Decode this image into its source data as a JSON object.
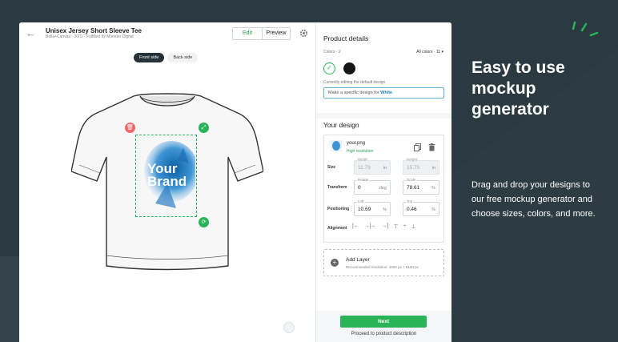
{
  "product": {
    "title": "Unisex Jersey Short Sleeve Tee",
    "subtitle": "Bella+Canvas · 3001 · Fulfilled by Monster Digital"
  },
  "header": {
    "edit_label": "Edit",
    "preview_label": "Preview"
  },
  "sides": {
    "front": "Front side",
    "back": "Back side"
  },
  "design_art_text": "Your Brand",
  "details": {
    "title": "Product details",
    "colors_label": "Colors · 2",
    "all_colors": "All colors · 11",
    "editing_note": "Currently editing the default design",
    "specific_prefix": "Make a specific design for ",
    "specific_color": "White",
    "swatches": [
      "#ffffff",
      "#151515"
    ]
  },
  "design": {
    "title": "Your design",
    "file_name": "your.png",
    "file_res": "High resolution",
    "size_label": "Size",
    "width_label": "Width",
    "width_value": "11.79",
    "width_unit": "in",
    "height_label": "Height",
    "height_value": "15.75",
    "height_unit": "in",
    "transform_label": "Transform",
    "rotate_label": "Rotate",
    "rotate_value": "0",
    "rotate_unit": "deg",
    "scale_label": "Scale",
    "scale_value": "78.61",
    "scale_unit": "%",
    "positioning_label": "Positioning",
    "left_label": "Left",
    "left_value": "10.69",
    "left_unit": "%",
    "top_label": "Top",
    "top_value": "0.46",
    "top_unit": "%",
    "alignment_label": "Alignment",
    "add_layer": "Add Layer",
    "add_layer_sub": "Recommended resolution: 4500 px × 5100 px"
  },
  "next": {
    "label": "Next",
    "sub": "Proceed to product description"
  },
  "promo": {
    "headline": "Easy to use mockup generator",
    "description": "Drag and drop your designs to our free mockup generator and choose sizes, colors, and more."
  },
  "colors": {
    "accent": "#2bb35a",
    "dark_bg": "#243238",
    "delete": "#ee6a6a"
  }
}
